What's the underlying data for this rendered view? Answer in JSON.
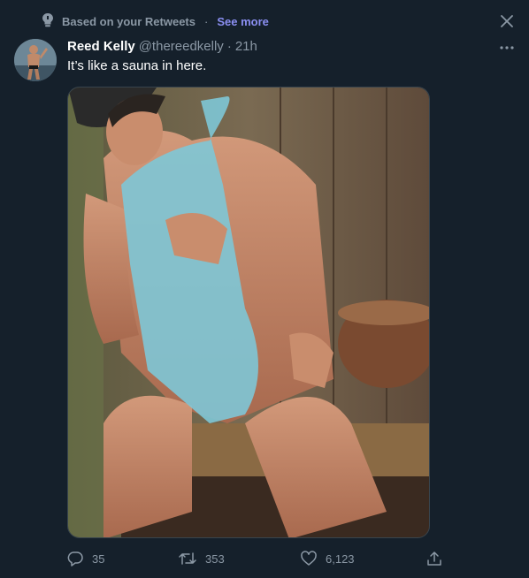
{
  "context": {
    "icon": "pin-icon",
    "label": "Based on your Retweets",
    "separator": "·",
    "link": "See more"
  },
  "tweet": {
    "author_name": "Reed Kelly",
    "handle": "@thereedkelly",
    "separator": "·",
    "time": "21h",
    "text": "It’s like a sauna in here."
  },
  "actions": {
    "reply_count": "35",
    "retweet_count": "353",
    "like_count": "6,123"
  },
  "colors": {
    "background": "#15202b",
    "secondary_text": "#8b98a5",
    "link": "#8b8ff2"
  }
}
